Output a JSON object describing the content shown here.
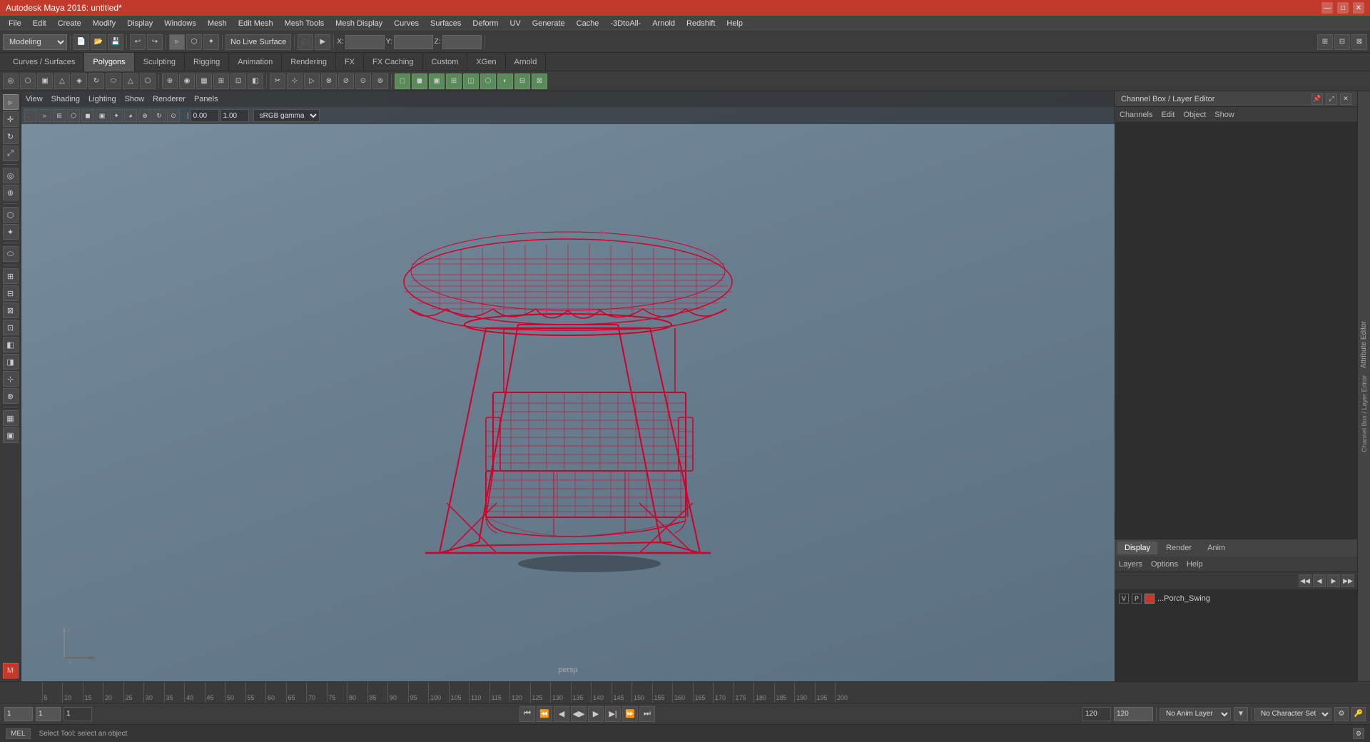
{
  "title_bar": {
    "title": "Autodesk Maya 2016: untitled*",
    "minimize": "—",
    "maximize": "□",
    "close": "✕"
  },
  "menu_bar": {
    "items": [
      "File",
      "Edit",
      "Create",
      "Modify",
      "Display",
      "Windows",
      "Mesh",
      "Edit Mesh",
      "Mesh Tools",
      "Mesh Display",
      "Curves",
      "Surfaces",
      "Deform",
      "UV",
      "Generate",
      "Cache",
      "-3DtoAll-",
      "Arnold",
      "Redshift",
      "Help"
    ]
  },
  "toolbar1": {
    "mode_select": "Modeling",
    "no_live_surface": "No Live Surface",
    "x_label": "X:",
    "y_label": "Y:",
    "z_label": "Z:"
  },
  "tabs": {
    "items": [
      "Curves / Surfaces",
      "Polygons",
      "Sculpting",
      "Rigging",
      "Animation",
      "Rendering",
      "FX",
      "FX Caching",
      "Custom",
      "XGen",
      "Arnold"
    ]
  },
  "tabs_active": "Polygons",
  "viewport": {
    "menus": [
      "View",
      "Shading",
      "Lighting",
      "Show",
      "Renderer",
      "Panels"
    ],
    "label": "persp",
    "gamma": "sRGB gamma",
    "gamma_value": "1.00",
    "offset_value": "0.00"
  },
  "channel_box": {
    "title": "Channel Box / Layer Editor",
    "tabs": [
      "Channels",
      "Edit",
      "Object",
      "Show"
    ]
  },
  "right_panel_tabs": [
    "Display",
    "Render",
    "Anim"
  ],
  "right_panel_active": "Display",
  "right_panel_subtabs": [
    "Layers",
    "Options",
    "Help"
  ],
  "layer": {
    "v": "V",
    "p": "P",
    "name": "...Porch_Swing"
  },
  "playback": {
    "start_frame": "1",
    "end_frame": "120",
    "current_frame": "1",
    "range_start": "1",
    "range_end": "120",
    "anim_layer": "No Anim Layer",
    "char_set": "No Character Set"
  },
  "status_bar": {
    "mode": "MEL",
    "text": "Select Tool: select an object"
  },
  "timeline_ticks": [
    5,
    10,
    15,
    20,
    25,
    30,
    35,
    40,
    45,
    50,
    55,
    60,
    65,
    70,
    75,
    80,
    85,
    90,
    95,
    100,
    105,
    110,
    115,
    120,
    125,
    130,
    135,
    140,
    145,
    150,
    155,
    160,
    165,
    170,
    175,
    180,
    185,
    190,
    195,
    200
  ]
}
